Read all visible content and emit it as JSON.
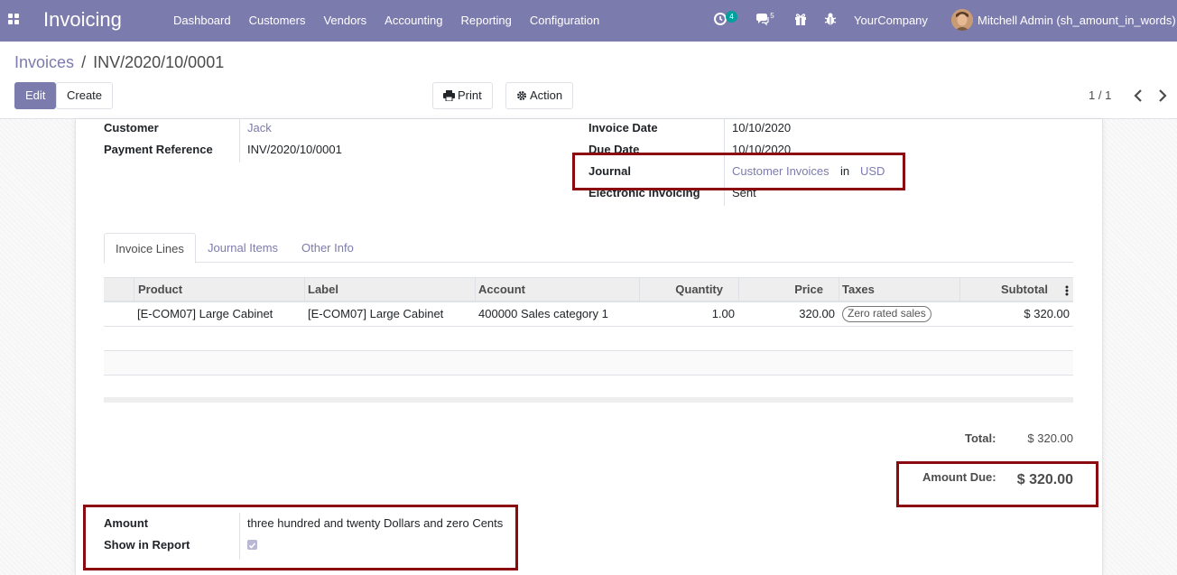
{
  "navbar": {
    "app_name": "Invoicing",
    "menu": [
      "Dashboard",
      "Customers",
      "Vendors",
      "Accounting",
      "Reporting",
      "Configuration"
    ],
    "activity_count": "4",
    "message_count": "5",
    "company": "YourCompany",
    "user": "Mitchell Admin (sh_amount_in_words)",
    "colors": {
      "navbar_bg": "#7c7bad",
      "activity_badge": "#00a09d"
    }
  },
  "breadcrumb": {
    "parent": "Invoices",
    "separator": "/",
    "current": "INV/2020/10/0001"
  },
  "toolbar": {
    "edit_label": "Edit",
    "create_label": "Create",
    "print_label": "Print",
    "action_label": "Action"
  },
  "pager": {
    "value": "1 / 1"
  },
  "form": {
    "customer_label": "Customer",
    "customer_value": "Jack",
    "payment_ref_label": "Payment Reference",
    "payment_ref_value": "INV/2020/10/0001",
    "invoice_date_label": "Invoice Date",
    "invoice_date_value": "10/10/2020",
    "due_date_label": "Due Date",
    "due_date_value": "10/10/2020",
    "journal_label": "Journal",
    "journal_value": "Customer Invoices",
    "journal_in": "in",
    "currency_value": "USD",
    "einvoicing_label": "Electronic invoicing",
    "einvoicing_value": "Sent"
  },
  "tabs": [
    "Invoice Lines",
    "Journal Items",
    "Other Info"
  ],
  "table": {
    "columns": [
      "Product",
      "Label",
      "Account",
      "Quantity",
      "Price",
      "Taxes",
      "Subtotal"
    ],
    "rows": [
      {
        "product": "[E-COM07] Large Cabinet",
        "label": "[E-COM07] Large Cabinet",
        "account": "400000 Sales category 1",
        "quantity": "1.00",
        "price": "320.00",
        "taxes": "Zero rated sales",
        "subtotal": "$ 320.00"
      }
    ]
  },
  "totals": {
    "total_label": "Total:",
    "total_value": "$ 320.00",
    "amount_due_label": "Amount Due:",
    "amount_due_value": "$ 320.00"
  },
  "words": {
    "amount_label": "Amount",
    "amount_value": "three hundred and twenty Dollars and zero Cents",
    "show_in_report_label": "Show in Report",
    "show_in_report_checked": true
  },
  "highlight_color": "#8b0a0f"
}
